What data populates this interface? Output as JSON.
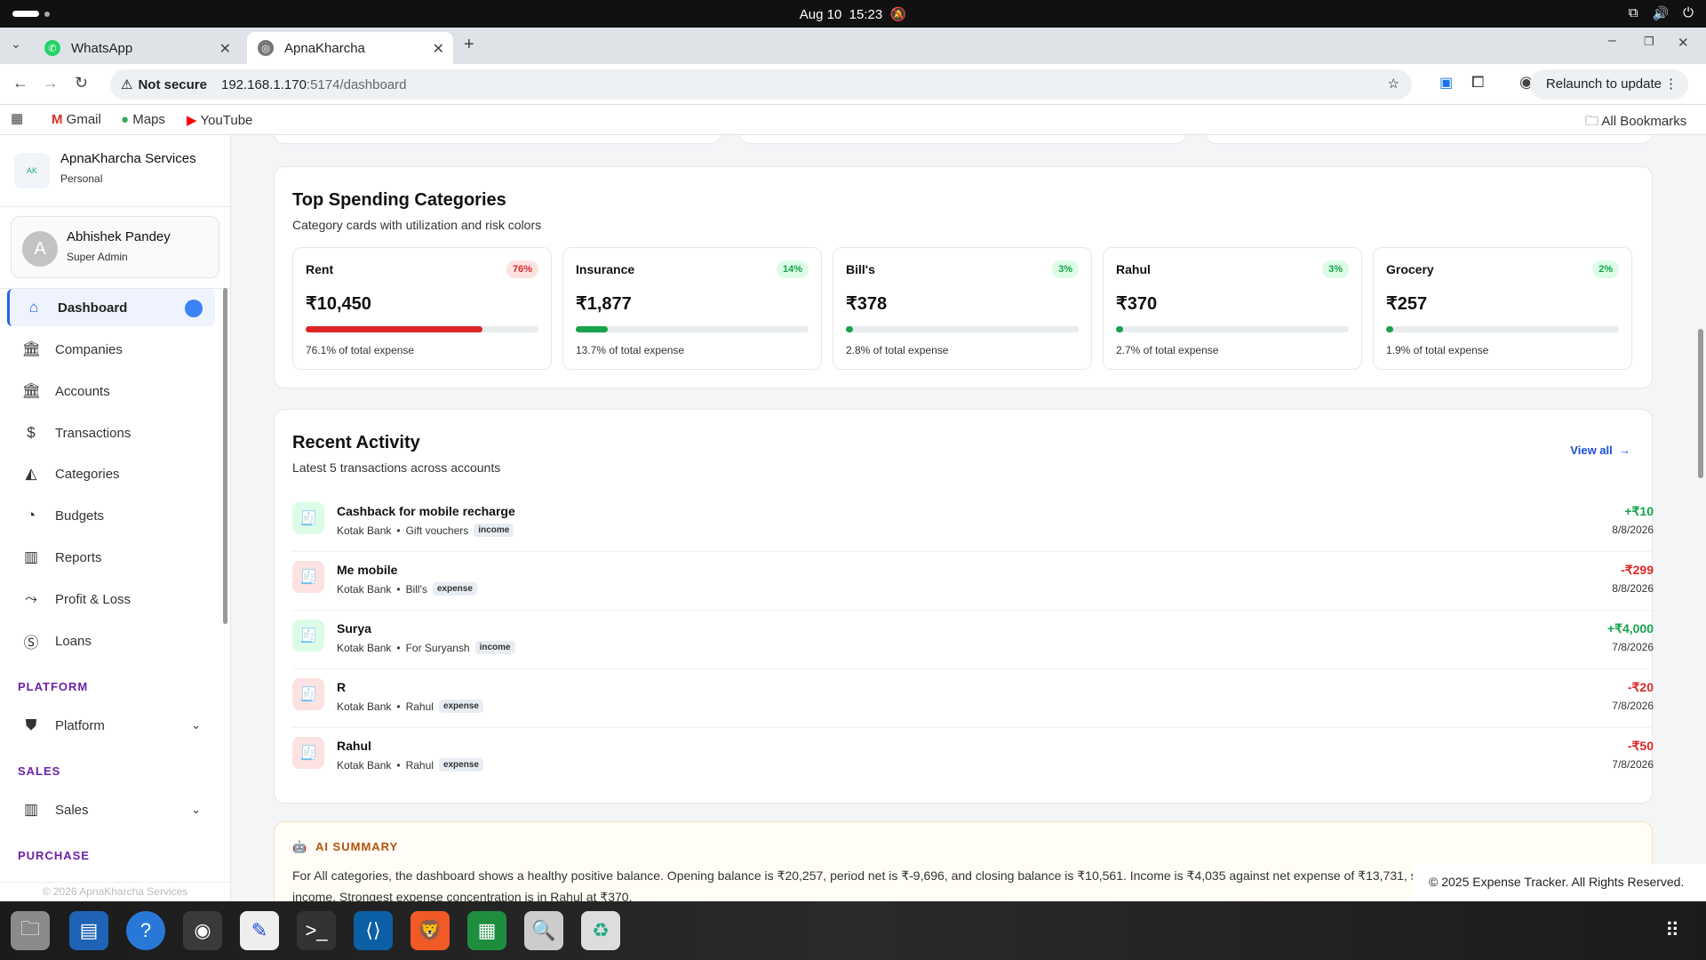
{
  "os": {
    "date": "Aug 10",
    "time": "15:23"
  },
  "browser": {
    "tabs": [
      {
        "label": "WhatsApp",
        "icon": "whatsapp-icon"
      },
      {
        "label": "ApnaKharcha",
        "icon": "globe-icon"
      }
    ],
    "not_secure": "Not secure",
    "url_host": "192.168.1.170",
    "url_path": ":5174/dashboard",
    "relaunch": "Relaunch to update",
    "bookmarks": [
      "Gmail",
      "Maps",
      "YouTube"
    ],
    "all_bookmarks": "All Bookmarks"
  },
  "sidebar": {
    "brand_name": "ApnaKharcha Services",
    "brand_type": "Personal",
    "user_initial": "A",
    "user_name": "Abhishek Pandey",
    "user_role": "Super Admin",
    "items": [
      {
        "label": "Dashboard",
        "icon": "home-icon"
      },
      {
        "label": "Companies",
        "icon": "bank-icon"
      },
      {
        "label": "Accounts",
        "icon": "bank-icon"
      },
      {
        "label": "Transactions",
        "icon": "dollar-icon"
      },
      {
        "label": "Categories",
        "icon": "shapes-icon"
      },
      {
        "label": "Budgets",
        "icon": "pie-icon"
      },
      {
        "label": "Reports",
        "icon": "bar-chart-icon"
      },
      {
        "label": "Profit & Loss",
        "icon": "trend-icon"
      },
      {
        "label": "Loans",
        "icon": "coin-icon"
      }
    ],
    "sections": {
      "platform": "PLATFORM",
      "platform_item": "Platform",
      "sales": "SALES",
      "sales_item": "Sales",
      "purchase": "PURCHASE"
    },
    "footer": "© 2026 ApnaKharcha Services"
  },
  "top_spending": {
    "title": "Top Spending Categories",
    "subtitle": "Category cards with utilization and risk colors",
    "categories": [
      {
        "name": "Rent",
        "badge": "76%",
        "amount": "₹10,450",
        "share": 76.1,
        "caption": "76.1% of total expense",
        "risk": "high"
      },
      {
        "name": "Insurance",
        "badge": "14%",
        "amount": "₹1,877",
        "share": 13.7,
        "caption": "13.7% of total expense",
        "risk": "low"
      },
      {
        "name": "Bill's",
        "badge": "3%",
        "amount": "₹378",
        "share": 2.8,
        "caption": "2.8% of total expense",
        "risk": "low"
      },
      {
        "name": "Rahul",
        "badge": "3%",
        "amount": "₹370",
        "share": 2.7,
        "caption": "2.7% of total expense",
        "risk": "low"
      },
      {
        "name": "Grocery",
        "badge": "2%",
        "amount": "₹257",
        "share": 1.9,
        "caption": "1.9% of total expense",
        "risk": "low"
      }
    ]
  },
  "recent": {
    "title": "Recent Activity",
    "subtitle": "Latest 5 transactions across accounts",
    "view_all": "View all",
    "items": [
      {
        "title": "Cashback for mobile recharge",
        "account": "Kotak Bank",
        "category": "Gift vouchers",
        "type": "income",
        "amount": "+₹10",
        "date": "8/8/2026"
      },
      {
        "title": "Me mobile",
        "account": "Kotak Bank",
        "category": "Bill's",
        "type": "expense",
        "amount": "-₹299",
        "date": "8/8/2026"
      },
      {
        "title": "Surya",
        "account": "Kotak Bank",
        "category": "For Suryansh",
        "type": "income",
        "amount": "+₹4,000",
        "date": "7/8/2026"
      },
      {
        "title": "R",
        "account": "Kotak Bank",
        "category": "Rahul",
        "type": "expense",
        "amount": "-₹20",
        "date": "7/8/2026"
      },
      {
        "title": "Rahul",
        "account": "Kotak Bank",
        "category": "Rahul",
        "type": "expense",
        "amount": "-₹50",
        "date": "7/8/2026"
      }
    ]
  },
  "ai_summary": {
    "label": "AI SUMMARY",
    "text_line1": "For All categories, the dashboard shows a healthy positive balance. Opening balance is ₹20,257, period net is ₹-9,696, and closing balance is ₹10,561. Income is ₹4,035 against net expense of ₹13,731, se",
    "text_line2": "income. Strongest expense concentration is in Rahul at ₹370."
  },
  "footer": "© 2025 Expense Tracker. All Rights Reserved.",
  "colors": {
    "accent": "#2563eb",
    "income": "#16a34a",
    "expense": "#dc2626"
  }
}
